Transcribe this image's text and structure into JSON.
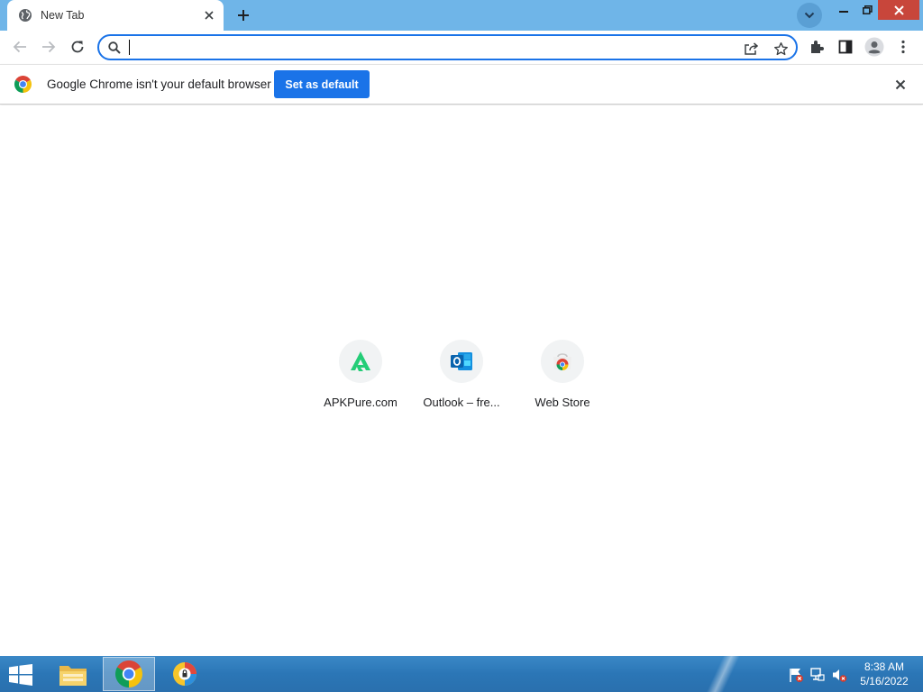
{
  "tab": {
    "title": "New Tab"
  },
  "omnibox": {
    "value": "",
    "placeholder": ""
  },
  "infobar": {
    "message": "Google Chrome isn't your default browser",
    "set_default_label": "Set as default"
  },
  "shortcuts": [
    {
      "label": "APKPure.com",
      "icon": "apkpure-icon"
    },
    {
      "label": "Outlook – fre...",
      "icon": "outlook-icon"
    },
    {
      "label": "Web Store",
      "icon": "chrome-web-store-icon"
    }
  ],
  "taskbar": {
    "time": "8:38 AM",
    "date": "5/16/2022"
  },
  "colors": {
    "titlebar": "#6fb5e8",
    "accent": "#1a73e8",
    "close_button": "#c8463b",
    "taskbar": "#2b76b6"
  }
}
